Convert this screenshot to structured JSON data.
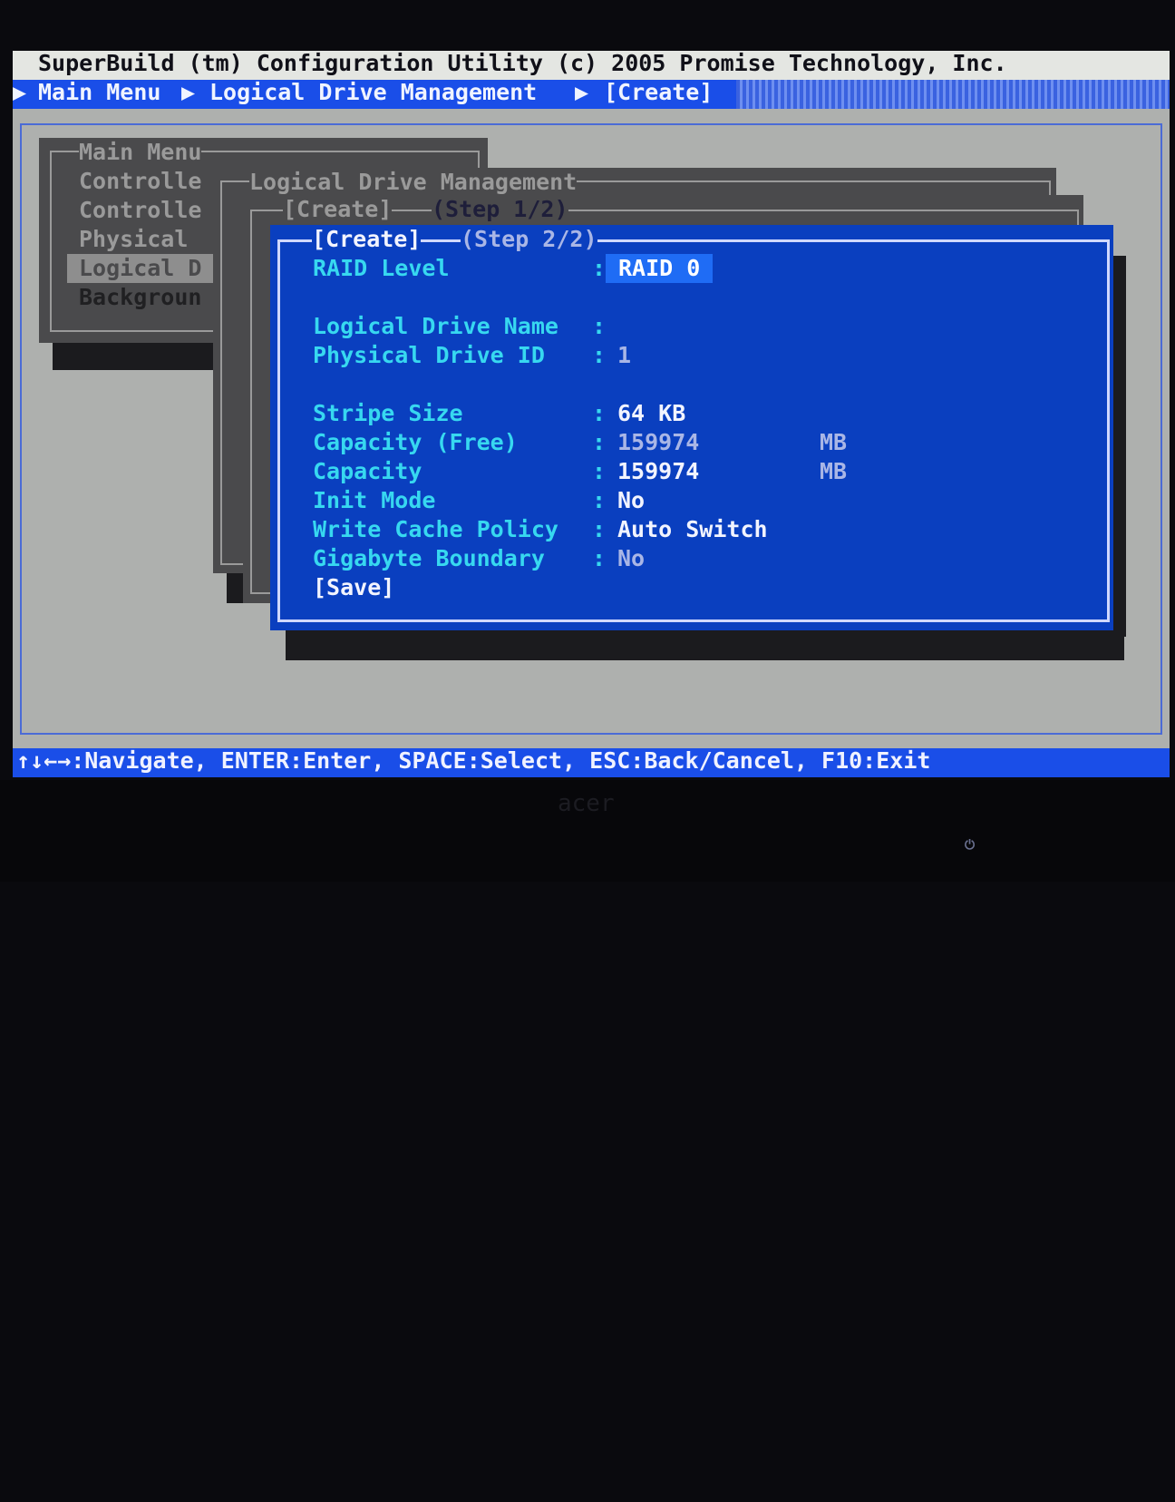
{
  "title": "SuperBuild (tm) Configuration Utility (c) 2005 Promise Technology, Inc.",
  "breadcrumb": [
    "Main Menu",
    "Logical Drive Management",
    "[Create]"
  ],
  "main_menu": {
    "title": "Main Menu",
    "items": [
      "Controlle",
      "Controlle",
      "Physical",
      "Logical D",
      "Backgroun"
    ],
    "selected": 3
  },
  "ldm_title": "Logical Drive Management",
  "step1": {
    "title": "[Create]",
    "step": "(Step 1/2)"
  },
  "step2": {
    "title": "[Create]",
    "step": "(Step 2/2)",
    "fields": [
      {
        "label": "RAID Level",
        "value": "RAID 0",
        "unit": ""
      },
      {
        "label": "Logical Drive Name",
        "value": "",
        "unit": ""
      },
      {
        "label": "Physical Drive ID",
        "value": "1",
        "unit": ""
      },
      {
        "label": "Stripe Size",
        "value": "64 KB",
        "unit": ""
      },
      {
        "label": "Capacity (Free)",
        "value": "159974",
        "unit": "MB"
      },
      {
        "label": "Capacity",
        "value": "159974",
        "unit": "MB"
      },
      {
        "label": "Init Mode",
        "value": "No",
        "unit": ""
      },
      {
        "label": "Write Cache Policy",
        "value": "Auto Switch",
        "unit": ""
      },
      {
        "label": "Gigabyte Boundary",
        "value": "No",
        "unit": ""
      }
    ],
    "save": "[Save]"
  },
  "footer": "↑↓←→:Navigate, ENTER:Enter, SPACE:Select, ESC:Back/Cancel, F10:Exit",
  "monitor_brand": "acer",
  "colors": {
    "dialog": "#0a3fbf",
    "label": "#37d8f0",
    "highlight": "#1f6cf5",
    "bar": "#1a4ee8"
  }
}
